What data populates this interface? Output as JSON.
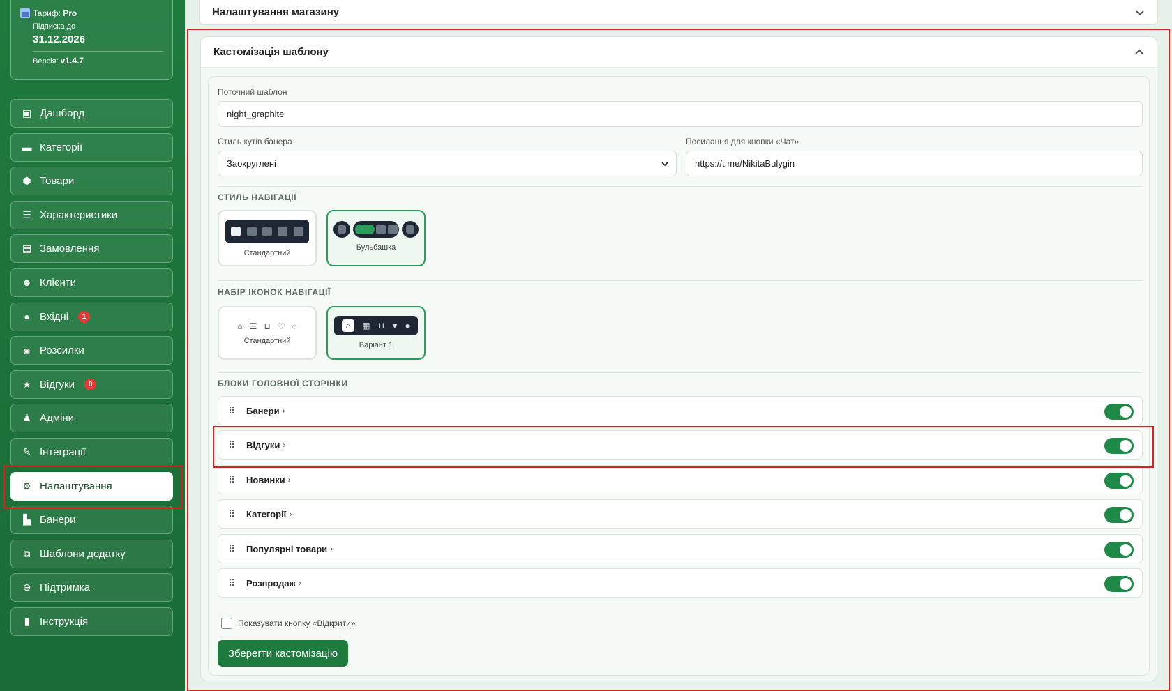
{
  "plan": {
    "tariff_label": "Тариф:",
    "tariff_value": "Pro",
    "subscription_label": "Підписка до",
    "subscription_date": "31.12.2026",
    "version_label": "Версія:",
    "version_value": "v1.4.7"
  },
  "sidebar": {
    "items": [
      {
        "label": "Дашборд",
        "icon": "dashboard-icon"
      },
      {
        "label": "Категорії",
        "icon": "folder-icon"
      },
      {
        "label": "Товари",
        "icon": "box-icon"
      },
      {
        "label": "Характеристики",
        "icon": "list-icon"
      },
      {
        "label": "Замовлення",
        "icon": "clipboard-icon"
      },
      {
        "label": "Клієнти",
        "icon": "users-icon"
      },
      {
        "label": "Вхідні",
        "icon": "chat-icon",
        "badge": "1"
      },
      {
        "label": "Розсилки",
        "icon": "broadcast-icon"
      },
      {
        "label": "Відгуки",
        "icon": "star-icon",
        "badge": "0"
      },
      {
        "label": "Адміни",
        "icon": "admin-icon"
      },
      {
        "label": "Інтеграції",
        "icon": "plug-icon"
      },
      {
        "label": "Налаштування",
        "icon": "gear-icon",
        "active": true
      },
      {
        "label": "Банери",
        "icon": "image-icon"
      },
      {
        "label": "Шаблони додатку",
        "icon": "template-icon"
      },
      {
        "label": "Підтримка",
        "icon": "lifebuoy-icon"
      },
      {
        "label": "Інструкція",
        "icon": "book-icon"
      }
    ]
  },
  "store_settings": {
    "title": "Налаштування магазину"
  },
  "customization": {
    "title": "Кастомізація шаблону",
    "current_template_label": "Поточний шаблон",
    "current_template_value": "night_graphite",
    "banner_corner_label": "Стиль кутів банера",
    "banner_corner_value": "Заокруглені",
    "chat_link_label": "Посилання для кнопки «Чат»",
    "chat_link_value": "https://t.me/NikitaBulygin",
    "nav_style_title": "СТИЛЬ НАВІГАЦІЇ",
    "nav_style_options": [
      {
        "label": "Стандартний",
        "selected": false
      },
      {
        "label": "Бульбашка",
        "selected": true
      }
    ],
    "nav_icons_title": "НАБІР ІКОНОК НАВІГАЦІЇ",
    "nav_icons_options": [
      {
        "label": "Стандартний",
        "selected": false
      },
      {
        "label": "Варіант 1",
        "selected": true
      }
    ],
    "home_blocks_title": "БЛОКИ ГОЛОВНОЇ СТОРІНКИ",
    "home_blocks": [
      {
        "label": "Банери",
        "enabled": true
      },
      {
        "label": "Відгуки",
        "enabled": true
      },
      {
        "label": "Новинки",
        "enabled": true
      },
      {
        "label": "Категорії",
        "enabled": true
      },
      {
        "label": "Популярні товари",
        "enabled": true
      },
      {
        "label": "Розпродаж",
        "enabled": true
      }
    ],
    "show_open_button_label": "Показувати кнопку «Відкрити»",
    "show_open_button_checked": false,
    "save_label": "Зберегти кастомізацію"
  },
  "colors": {
    "sidebar_green": "#1f7a3e",
    "accent_green": "#2a9d5a",
    "highlight_red": "#e01e1e",
    "badge_red": "#e53935"
  }
}
